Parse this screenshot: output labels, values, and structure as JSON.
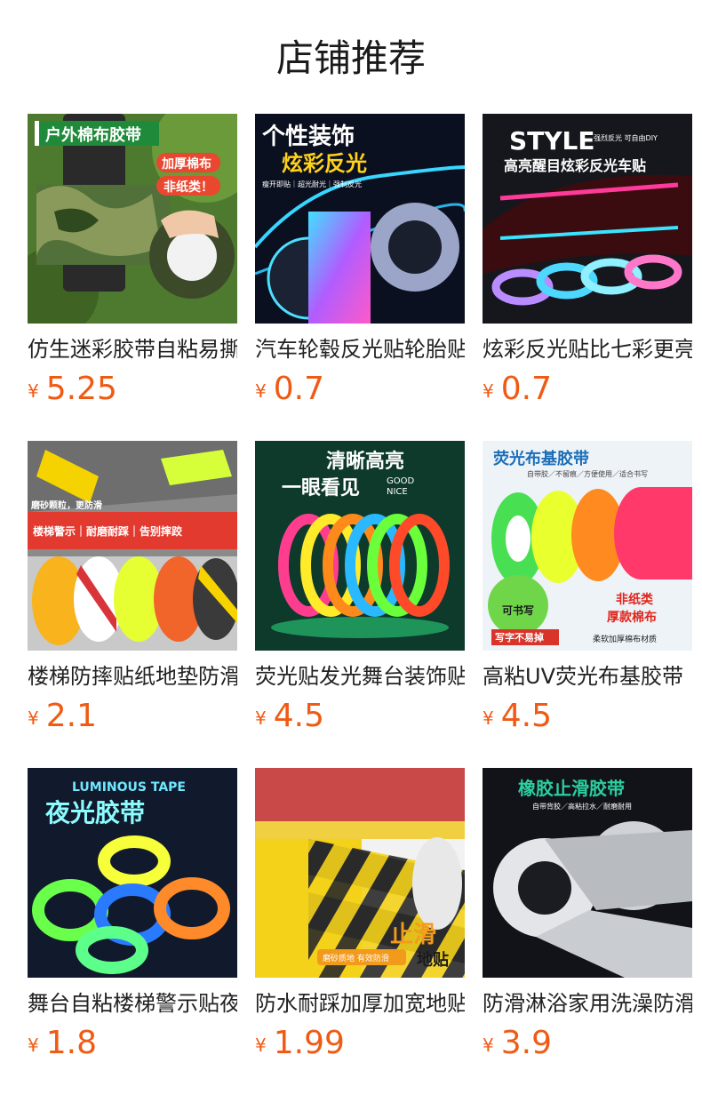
{
  "page": {
    "title": "店铺推荐"
  },
  "currency": "¥",
  "products": [
    {
      "name": "仿生迷彩胶带自粘易撕",
      "price": "5.25",
      "image_text": [
        "户外棉布胶带",
        "加厚棉布",
        "非纸类！"
      ]
    },
    {
      "name": "汽车轮毂反光贴轮胎贴",
      "price": "0.7",
      "image_text": [
        "个性装饰",
        "炫彩反光",
        "瘦开即贴｜超光耐光｜强制反光"
      ]
    },
    {
      "name": "炫彩反光贴比七彩更亮",
      "price": "0.7",
      "image_text": [
        "STYLE",
        "强烈反光  可自由DIY",
        "高亮醒目炫彩反光车贴"
      ]
    },
    {
      "name": "楼梯防摔贴纸地垫防滑",
      "price": "2.1",
      "image_text": [
        "磨砂颗粒，更防滑",
        "楼梯警示｜耐磨耐踩｜告别摔跤"
      ]
    },
    {
      "name": "荧光贴发光舞台装饰贴",
      "price": "4.5",
      "image_text": [
        "清晰高亮",
        "一眼看见",
        "GOOD",
        "NICE"
      ]
    },
    {
      "name": "高粘UV荧光布基胶带",
      "price": "4.5",
      "image_text": [
        "荧光布基胶带",
        "自带胶／不留痕／方便使用／适合书写",
        "写字不易掉",
        "非纸类",
        "厚款棉布",
        "柔软加厚棉布材质",
        "可书写"
      ]
    },
    {
      "name": "舞台自粘楼梯警示贴夜",
      "price": "1.8",
      "image_text": [
        "LUMINOUS TAPE",
        "夜光胶带"
      ]
    },
    {
      "name": "防水耐踩加厚加宽地贴",
      "price": "1.99",
      "image_text": [
        "止滑",
        "地贴",
        "磨砂质地 有效防滑"
      ]
    },
    {
      "name": "防滑淋浴家用洗澡防滑",
      "price": "3.9",
      "image_text": [
        "橡胶止滑胶带",
        "自带背胶／高粘拉水／耐磨耐用"
      ]
    }
  ]
}
